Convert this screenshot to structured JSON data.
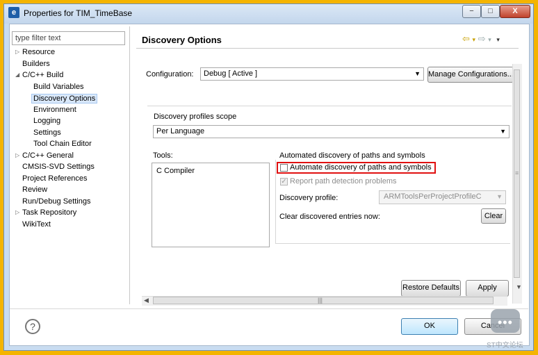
{
  "window": {
    "title": "Properties for TIM_TimeBase",
    "icon": "eclipse-properties-icon",
    "controls": {
      "minimize": "−",
      "maximize": "□",
      "close": "X"
    }
  },
  "filter": {
    "placeholder": "type filter text"
  },
  "tree": {
    "items": [
      {
        "label": "Resource",
        "twisty": "▷",
        "selected": false
      },
      {
        "label": "Builders",
        "twisty": "",
        "selected": false
      },
      {
        "label": "C/C++ Build",
        "twisty": "◢",
        "selected": false
      },
      {
        "label": "Build Variables",
        "twisty": "",
        "selected": false
      },
      {
        "label": "Discovery Options",
        "twisty": "",
        "selected": true
      },
      {
        "label": "Environment",
        "twisty": "",
        "selected": false
      },
      {
        "label": "Logging",
        "twisty": "",
        "selected": false
      },
      {
        "label": "Settings",
        "twisty": "",
        "selected": false
      },
      {
        "label": "Tool Chain Editor",
        "twisty": "",
        "selected": false
      },
      {
        "label": "C/C++ General",
        "twisty": "▷",
        "selected": false
      },
      {
        "label": "CMSIS-SVD Settings",
        "twisty": "",
        "selected": false
      },
      {
        "label": "Project References",
        "twisty": "",
        "selected": false
      },
      {
        "label": "Review",
        "twisty": "",
        "selected": false
      },
      {
        "label": "Run/Debug Settings",
        "twisty": "",
        "selected": false
      },
      {
        "label": "Task Repository",
        "twisty": "▷",
        "selected": false
      },
      {
        "label": "WikiText",
        "twisty": "",
        "selected": false
      }
    ]
  },
  "page": {
    "title": "Discovery Options",
    "history": {
      "back": "⇦",
      "back_menu": "▾",
      "forward": "⇨",
      "forward_menu": "▾",
      "view_menu": "▾"
    },
    "configuration": {
      "label": "Configuration:",
      "value": "Debug  [ Active ]",
      "manage_button": "Manage Configurations..."
    },
    "scope": {
      "label": "Discovery profiles scope",
      "value": "Per Language"
    },
    "tools": {
      "label": "Tools:",
      "items": [
        "C Compiler"
      ]
    },
    "automated": {
      "group_label": "Automated discovery of paths and symbols",
      "auto_checkbox": {
        "label": "Automate discovery of paths and symbols",
        "checked": false
      },
      "report_checkbox": {
        "label": "Report path detection problems",
        "checked": true,
        "disabled": true,
        "mark": "✓"
      },
      "profile_label": "Discovery profile:",
      "profile_value": "ARMToolsPerProjectProfileC",
      "clear_label": "Clear discovered entries now:",
      "clear_button": "Clear"
    },
    "restore_button": "Restore Defaults",
    "apply_button": "Apply"
  },
  "footer": {
    "help": "?",
    "ok_button": "OK",
    "cancel_button": "Cancel"
  },
  "watermark": {
    "text": "ST中文论坛"
  },
  "colors": {
    "highlight": "#e01010",
    "frame": "#f4b400"
  }
}
